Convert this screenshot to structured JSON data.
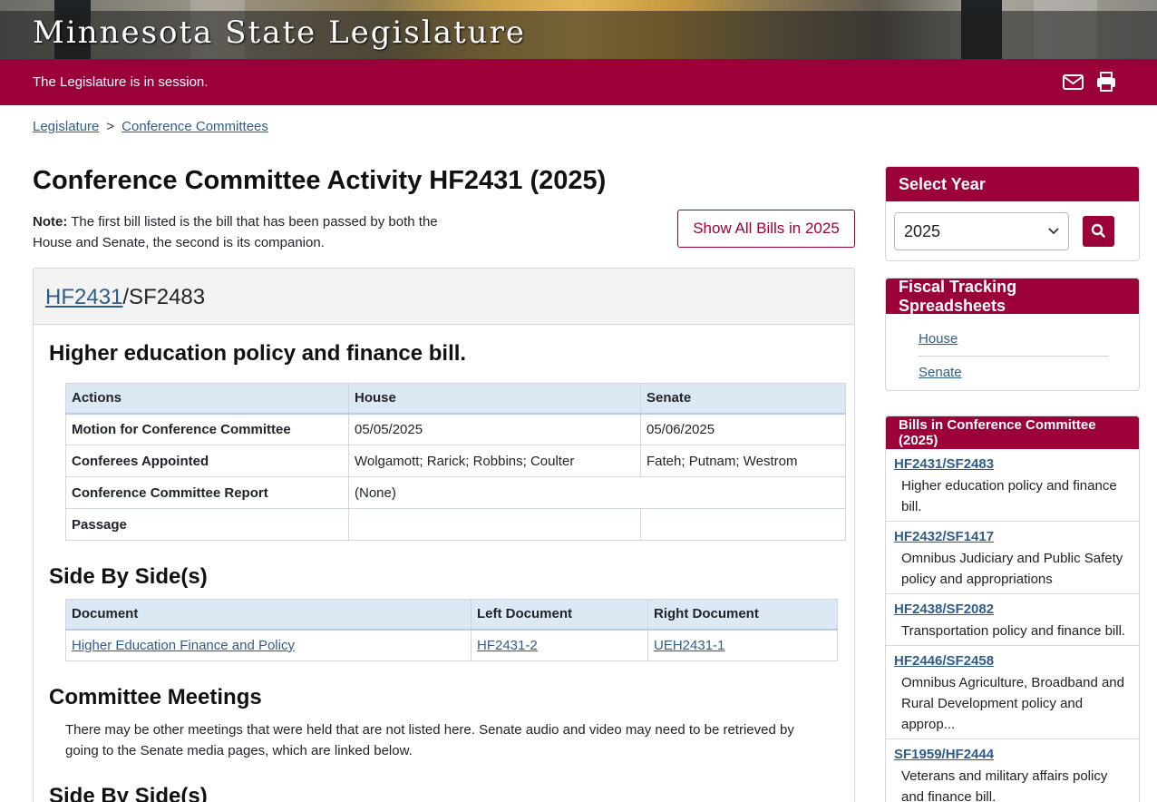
{
  "header": {
    "site_title": "Minnesota State Legislature",
    "status": "The Legislature is in session."
  },
  "breadcrumb": {
    "items": [
      "Legislature",
      "Conference Committees"
    ],
    "separator": ">"
  },
  "main": {
    "title": "Conference Committee Activity HF2431 (2025)",
    "note_label": "Note:",
    "note_text": " The first bill listed is the bill that has been passed by both the House and Senate, the second is its companion.",
    "show_all_button": "Show All Bills in 2025",
    "bill": {
      "primary": "HF2431",
      "companion": "/SF2483",
      "description": "Higher education policy and finance bill."
    },
    "actions_table": {
      "headers": [
        "Actions",
        "House",
        "Senate"
      ],
      "rows": [
        [
          "Motion for Conference Committee",
          "05/05/2025",
          "05/06/2025"
        ],
        [
          "Conferees Appointed",
          "Wolgamott; Rarick; Robbins; Coulter",
          "Fateh; Putnam; Westrom"
        ],
        [
          "Conference Committee Report",
          "(None)",
          ""
        ],
        [
          "Passage",
          "",
          ""
        ]
      ]
    },
    "sbs_title": "Side By Side(s)",
    "sbs_table": {
      "headers": [
        "Document",
        "Left Document",
        "Right Document"
      ],
      "rows": [
        [
          "Higher Education Finance and Policy",
          "HF2431-2",
          "UEH2431-1"
        ]
      ]
    },
    "meetings_title": "Committee Meetings",
    "meetings_text": "There may be other meetings that were held that are not listed here. Senate audio and video may need to be retrieved by going to the Senate media pages, which are linked below.",
    "sbs2_title": "Side By Side(s)"
  },
  "sidebar": {
    "select_year": {
      "title": "Select Year",
      "value": "2025"
    },
    "fiscal": {
      "title": "Fiscal Tracking Spreadsheets",
      "links": [
        "House",
        "Senate"
      ]
    },
    "bills": {
      "title": "Bills in Conference Committee (2025)",
      "items": [
        {
          "bill": "HF2431/SF2483",
          "desc": "Higher education policy and finance bill."
        },
        {
          "bill": "HF2432/SF1417",
          "desc": "Omnibus Judiciary and Public Safety policy and appropriations"
        },
        {
          "bill": "HF2438/SF2082",
          "desc": "Transportation policy and finance bill."
        },
        {
          "bill": "HF2446/SF2458",
          "desc": "Omnibus Agriculture, Broadband and Rural Development policy and approp..."
        },
        {
          "bill": "SF1959/HF2444",
          "desc": "Veterans and military affairs policy and finance bill."
        }
      ]
    }
  },
  "colors": {
    "brand": "#9c0039",
    "link": "#2f5d8a",
    "table_header": "#dce8f4"
  },
  "icons": [
    "envelope-icon",
    "printer-icon",
    "search-icon",
    "chevron-down-icon"
  ]
}
